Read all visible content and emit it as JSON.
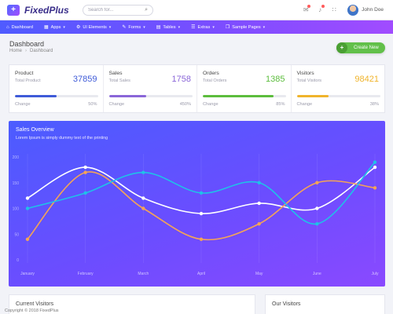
{
  "app": {
    "logo_mark": "+",
    "name": "FixedPlus",
    "search_placeholder": "Search for...",
    "user_name": "John Doe"
  },
  "nav": [
    {
      "label": "Dashboard",
      "icon": "⌂",
      "dropdown": false
    },
    {
      "label": "Apps",
      "icon": "▦",
      "dropdown": true
    },
    {
      "label": "UI Elements",
      "icon": "⚙",
      "dropdown": true
    },
    {
      "label": "Forms",
      "icon": "✎",
      "dropdown": true
    },
    {
      "label": "Tables",
      "icon": "▤",
      "dropdown": true
    },
    {
      "label": "Extras",
      "icon": "☰",
      "dropdown": true
    },
    {
      "label": "Sample Pages",
      "icon": "❐",
      "dropdown": true
    }
  ],
  "header": {
    "title": "Dashboard",
    "breadcrumb": [
      "Home",
      "Dashboard"
    ],
    "create_label": "Create New"
  },
  "stats": [
    {
      "title": "Product",
      "sub": "Total Product",
      "value": "37859",
      "change_label": "Change",
      "change": "50%",
      "fraction": 0.5,
      "color": "#3f5bd8"
    },
    {
      "title": "Sales",
      "sub": "Total Sales",
      "value": "1758",
      "change_label": "Change",
      "change": "450%",
      "fraction": 0.45,
      "color": "#8a66d8"
    },
    {
      "title": "Orders",
      "sub": "Total Orders",
      "value": "1385",
      "change_label": "Change",
      "change": "85%",
      "fraction": 0.85,
      "color": "#5cbd3d"
    },
    {
      "title": "Visitors",
      "sub": "Total Visitors",
      "value": "98421",
      "change_label": "Change",
      "change": "38%",
      "fraction": 0.38,
      "color": "#f0b42c"
    }
  ],
  "sales": {
    "title": "Sales Overview",
    "subtitle": "Lorem Ipsum is simply dummy text of the printing"
  },
  "chart_data": {
    "type": "line",
    "categories": [
      "January",
      "February",
      "March",
      "April",
      "May",
      "June",
      "July"
    ],
    "ylim": [
      0,
      200
    ],
    "yticks": [
      0,
      50,
      100,
      150,
      200
    ],
    "grid": true,
    "series": [
      {
        "color": "#ffffff",
        "values": [
          120,
          180,
          120,
          90,
          110,
          100,
          180
        ]
      },
      {
        "color": "#f5a455",
        "values": [
          40,
          170,
          100,
          40,
          70,
          150,
          140
        ]
      },
      {
        "color": "#1fc2e8",
        "values": [
          100,
          130,
          170,
          130,
          150,
          70,
          190
        ]
      }
    ]
  },
  "bottom": {
    "current_visitors": "Current Visitors",
    "our_visitors": "Our Visitors",
    "copyright": "Copyright © 2018 FixedPlus"
  }
}
